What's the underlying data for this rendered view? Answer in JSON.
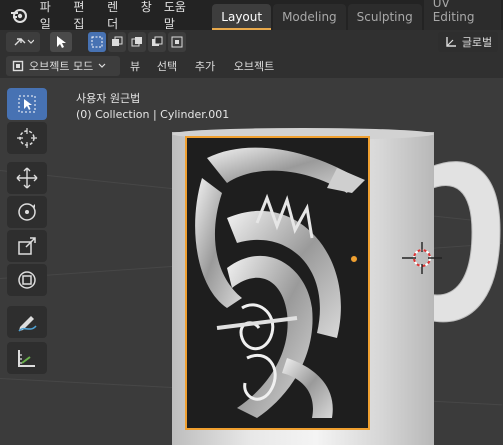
{
  "menu": {
    "file": "파일",
    "edit": "편집",
    "render": "렌더",
    "window": "창",
    "help": "도움말"
  },
  "workspace_tabs": [
    {
      "label": "Layout",
      "active": true
    },
    {
      "label": "Modeling",
      "active": false
    },
    {
      "label": "Sculpting",
      "active": false
    },
    {
      "label": "UV Editing",
      "active": false
    }
  ],
  "header": {
    "orientation_label": "글로벌"
  },
  "viewport_header": {
    "mode_label": "오브젝트 모드",
    "view_label": "뷰",
    "select_label": "선택",
    "add_label": "추가",
    "object_label": "오브젝트"
  },
  "viewport": {
    "perspective_label": "사용자 원근법",
    "collection_label": "(0) Collection | Cylinder.001"
  },
  "colors": {
    "accent": "#4772b3",
    "active_tab_underline": "#e8a94c",
    "selection_outline": "#f0a030"
  }
}
